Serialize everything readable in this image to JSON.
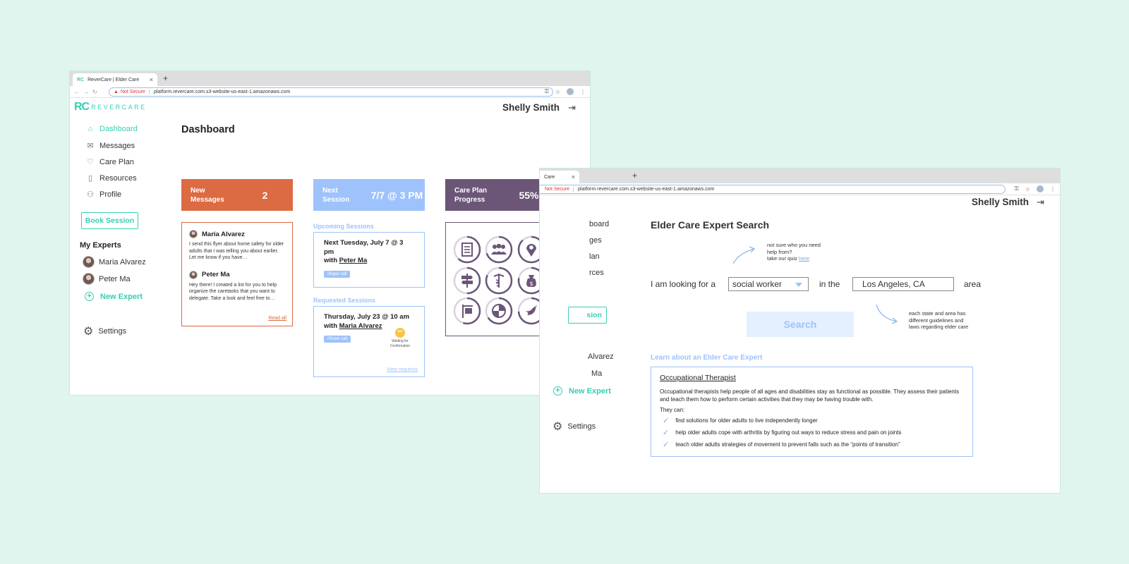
{
  "browser": {
    "tab_title": "ReverCare | Elder Care",
    "tab_title_short": "Care",
    "favicon": "RC",
    "close": "×",
    "new_tab": "+",
    "not_secure": "Not Secure",
    "url": "platform.revercare.com.s3-website-us-east-1.amazonaws.com"
  },
  "app": {
    "logo_mark": "RC",
    "logo_text": "REVERCARE",
    "user_name": "Shelly Smith",
    "logout_icon": "logout-icon"
  },
  "sidebar": {
    "items": [
      {
        "label": "Dashboard",
        "icon": "home-icon"
      },
      {
        "label": "Messages",
        "icon": "envelope-icon"
      },
      {
        "label": "Care Plan",
        "icon": "heart-icon"
      },
      {
        "label": "Resources",
        "icon": "document-icon"
      },
      {
        "label": "Profile",
        "icon": "user-icon"
      }
    ],
    "book_session": "Book Session",
    "my_experts": "My Experts",
    "experts": [
      "Maria Alvarez",
      "Peter Ma"
    ],
    "new_expert": "New Expert",
    "settings": "Settings",
    "partial_items": [
      "board",
      "ges",
      "lan",
      "rces"
    ],
    "partial_book": "sion",
    "partial_experts": [
      "Alvarez",
      "Ma"
    ]
  },
  "dashboard": {
    "title": "Dashboard",
    "stats": [
      {
        "label": "New\nMessages",
        "value": "2",
        "color": "#dc6a43"
      },
      {
        "label": "Next\nSession",
        "value": "7/7 @ 3 PM",
        "color": "#9ec2fb"
      },
      {
        "label": "Care Plan\nProgress",
        "value": "55%",
        "color": "#6b5678"
      }
    ],
    "messages": [
      {
        "from": "Maria Alvarez",
        "body": "I send this flyer about home safety for older adults that I was telling you about earlier. Let me know if you have…"
      },
      {
        "from": "Peter Ma",
        "body": "Hey there! I created a list for you to help organize the caretasks that you want to delegate. Take a look and feel free to…"
      }
    ],
    "read_all": "Read all",
    "upcoming_header": "Upcoming Sessions",
    "upcoming": {
      "line1": "Next Tuesday, July 7 @ 3 pm",
      "with": "with",
      "expert": "Peter Ma",
      "type": "Skype call"
    },
    "requested_header": "Requested Sessions",
    "requested": {
      "line1": "Thursday, July 23 @ 10 am",
      "with": "with",
      "expert": "Maria Alvarez",
      "type": "Phone call",
      "status": "Waiting for Confirmation",
      "status_dots": "•••"
    },
    "view_requests": "View requests",
    "care_plan_icons": [
      "checklist-icon",
      "group-icon",
      "location-icon",
      "signpost-icon",
      "medical-icon",
      "money-bag-icon",
      "house-sign-icon",
      "shield-icon",
      "dove-icon"
    ],
    "care_plan_progress": [
      0.62,
      0.7,
      0.88,
      0.5,
      0.82,
      0.78,
      0.55,
      0.66,
      0.74
    ],
    "accent": "#6b5678"
  },
  "search": {
    "title": "Elder Care Expert Search",
    "quiz_note_l1": "not sure who you need",
    "quiz_note_l2": "help from?",
    "quiz_note_l3": "take our quiz",
    "quiz_link": "here",
    "sentence_1": "I am looking for a",
    "role_value": "social worker",
    "sentence_2": "in the",
    "location_value": "Los Angeles, CA",
    "sentence_3": "area",
    "search_button": "Search",
    "area_note_l1": "each state and area has",
    "area_note_l2": "different guidelines and",
    "area_note_l3": "laws regarding elder care",
    "learn_header": "Learn about an Elder Care Expert",
    "info": {
      "title": "Occupational Therapist",
      "description": "Occupational therapists help people of all ages and disabilities stay as functional as possible. They assess their patients and teach them how to perform certain activities that they may be having trouble with.",
      "they_can": "They can:",
      "bullets": [
        "find solutions for older adults to live independently longer",
        "help older adults cope with arthritis by figuring out ways to reduce stress and pain on joints",
        "teach older adults strategies of movement to prevent falls such as the “points of transition”"
      ]
    }
  }
}
